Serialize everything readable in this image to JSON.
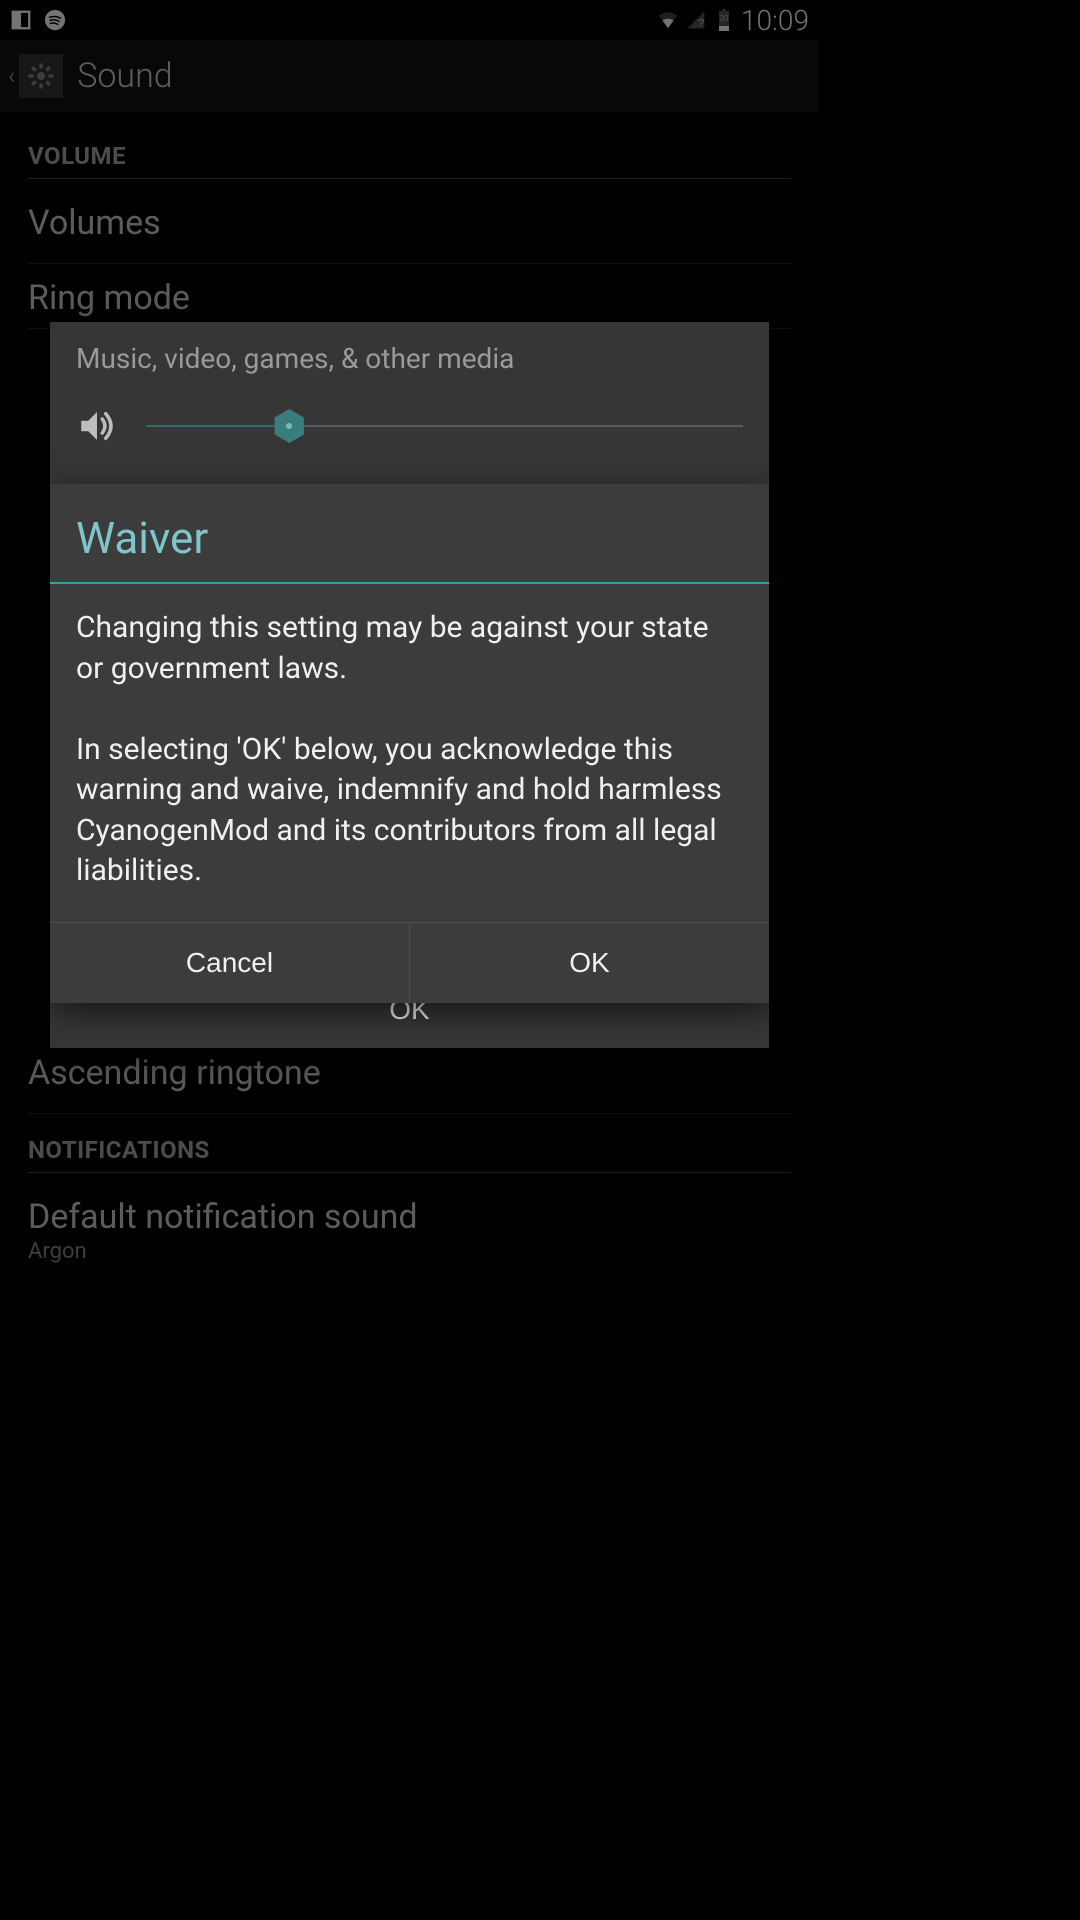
{
  "statusbar": {
    "time": "10:09",
    "battery_level": "20"
  },
  "actionbar": {
    "title": "Sound"
  },
  "settings": {
    "section_volume": "VOLUME",
    "items": [
      {
        "title": "Volumes"
      },
      {
        "title": "Ring mode"
      }
    ],
    "ascending": "Ascending ringtone",
    "section_notifications": "NOTIFICATIONS",
    "notif_item_title": "Default notification sound",
    "notif_item_sub": "Argon"
  },
  "volume_dialog": {
    "label": "Music, video, games, & other media",
    "slider_percent": 24,
    "ok": "OK"
  },
  "waiver_dialog": {
    "title": "Waiver",
    "body": "Changing this setting may be against your state or government laws.\n\nIn selecting 'OK' below, you acknowledge this warning and waive, indemnify and hold harmless CyanogenMod and its contributors from all legal liabilities.",
    "cancel": "Cancel",
    "ok": "OK"
  }
}
